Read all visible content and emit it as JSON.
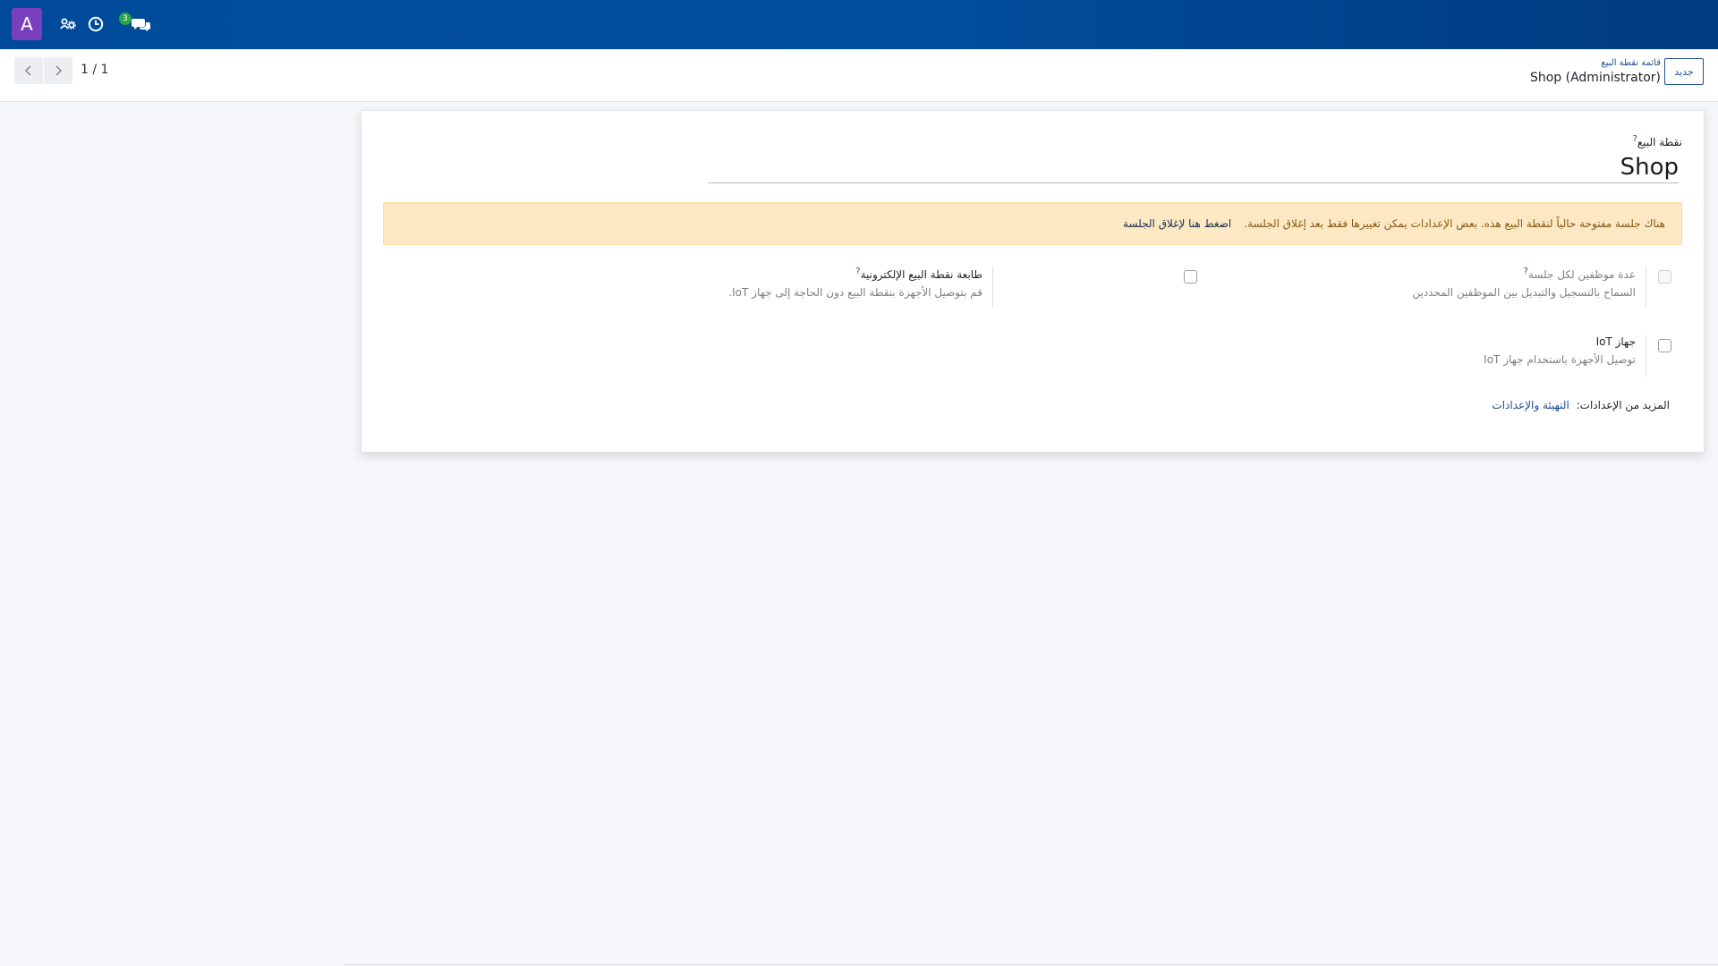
{
  "navbar": {
    "avatar_letter": "A",
    "icons": [
      "users-gear-icon",
      "clock-icon",
      "chat-icon"
    ],
    "chat_badge": "3",
    "brand_color": "#014a9a"
  },
  "control_panel": {
    "pager": "1 / 1",
    "breadcrumb": "قائمة نقطة البيع",
    "record_name": "Shop (Administrator)",
    "new_button_label": "جديد"
  },
  "form": {
    "name_label": "نقطة البيع",
    "help_mark": "?",
    "name_value": "Shop",
    "alert": {
      "text": "هناك جلسة مفتوحة حالياً لنقطة البيع هذه. بعض الإعدادات يمكن تغييرها فقط بعد إغلاق الجلسة.",
      "link": "اضغط هنا لإغلاق الجلسة"
    },
    "settings": [
      {
        "title": "عدة موظفين لكل جلسة",
        "description": "السماح بالتسجيل والتبديل بين الموظفين المحددين",
        "checked": false,
        "disabled": true
      },
      {
        "title": "طابعة نقطة البيع الإلكترونية",
        "description": "قم بتوصيل الأجهزة بنقطة البيع دون الحاجة إلى جهاز IoT.",
        "checked": false,
        "disabled": false
      },
      {
        "title": "جهاز IoT",
        "description": "توصيل الأجهزة باستخدام جهاز IoT",
        "checked": false,
        "disabled": false
      }
    ],
    "more_settings_label": "المزيد من الإعدادات:",
    "more_settings_link": "التهيئة والإعدادات"
  }
}
